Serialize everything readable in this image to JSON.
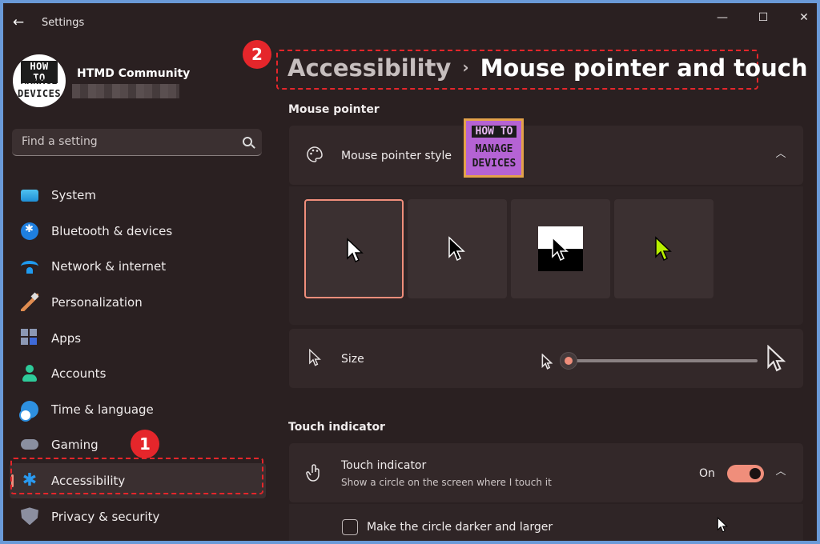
{
  "window": {
    "title": "Settings",
    "controls": {
      "minimize": "—",
      "maximize": "☐",
      "close": "✕"
    }
  },
  "profile": {
    "name": "HTMD Community",
    "logo_lines": [
      "HOW TO",
      "MANAGE",
      "DEVICES"
    ]
  },
  "search": {
    "placeholder": "Find a setting",
    "value": ""
  },
  "sidebar": {
    "items": [
      {
        "label": "System",
        "icon": "system-icon"
      },
      {
        "label": "Bluetooth & devices",
        "icon": "bluetooth-icon"
      },
      {
        "label": "Network & internet",
        "icon": "wifi-icon"
      },
      {
        "label": "Personalization",
        "icon": "brush-icon"
      },
      {
        "label": "Apps",
        "icon": "apps-icon"
      },
      {
        "label": "Accounts",
        "icon": "person-icon"
      },
      {
        "label": "Time & language",
        "icon": "clock-globe-icon"
      },
      {
        "label": "Gaming",
        "icon": "gamepad-icon"
      },
      {
        "label": "Accessibility",
        "icon": "accessibility-icon",
        "selected": true
      },
      {
        "label": "Privacy & security",
        "icon": "shield-icon"
      }
    ]
  },
  "annotations": {
    "badge_1": "1",
    "badge_2": "2"
  },
  "breadcrumb": {
    "parent": "Accessibility",
    "separator": "›",
    "current": "Mouse pointer and touch"
  },
  "sections": {
    "mouse_pointer": "Mouse pointer",
    "touch_indicator": "Touch indicator"
  },
  "mouse_pointer_style": {
    "label": "Mouse pointer style",
    "watermark_lines": [
      "HOW TO",
      "MANAGE",
      "DEVICES"
    ],
    "options": [
      "white",
      "black",
      "inverted",
      "custom"
    ],
    "selected": "white"
  },
  "size": {
    "label": "Size",
    "value_fraction": 0.0
  },
  "touch_indicator": {
    "label": "Touch indicator",
    "description": "Show a circle on the screen where I touch it",
    "state_label": "On",
    "on": true,
    "checkbox_label": "Make the circle darker and larger",
    "checkbox_checked": false
  },
  "colors": {
    "accent": "#f08e7b",
    "annotation_red": "#e5262b",
    "background": "#2a2021"
  }
}
